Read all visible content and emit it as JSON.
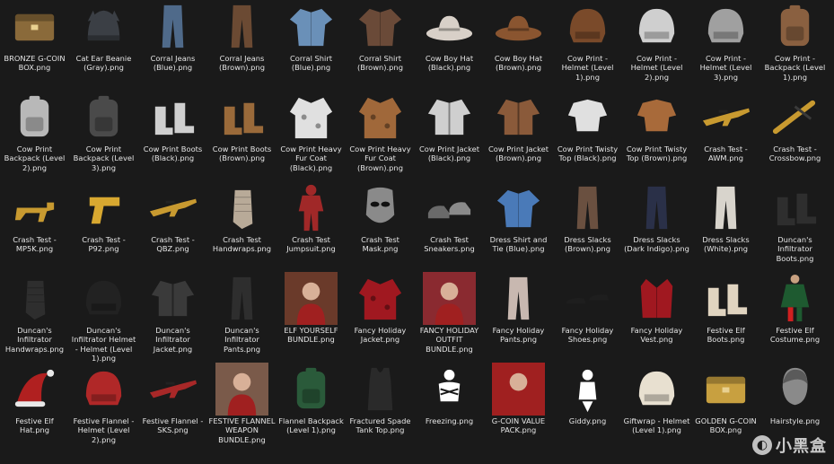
{
  "files": [
    {
      "name": "BRONZE G-COIN BOX.png",
      "icon": "crate-icon",
      "color": "#8a6a3a"
    },
    {
      "name": "Cat Ear Beanie (Gray).png",
      "icon": "beanie-icon",
      "color": "#3b3f45"
    },
    {
      "name": "Corral Jeans (Blue).png",
      "icon": "pants-icon",
      "color": "#4f6a8a"
    },
    {
      "name": "Corral Jeans (Brown).png",
      "icon": "pants-icon",
      "color": "#6b4a33"
    },
    {
      "name": "Corral Shirt (Blue).png",
      "icon": "shirt-icon",
      "color": "#6a90b8"
    },
    {
      "name": "Corral Shirt (Brown).png",
      "icon": "shirt-icon",
      "color": "#6a4a38"
    },
    {
      "name": "Cow Boy Hat (Black).png",
      "icon": "hat-icon",
      "color": "#d8d0c8"
    },
    {
      "name": "Cow Boy Hat (Brown).png",
      "icon": "hat-icon",
      "color": "#8a5530"
    },
    {
      "name": "Cow Print - Helmet (Level 1).png",
      "icon": "helmet-icon",
      "color": "#7a4a2a"
    },
    {
      "name": "Cow Print - Helmet (Level 2).png",
      "icon": "helmet-icon",
      "color": "#cfcfcf"
    },
    {
      "name": "Cow Print - Helmet (Level 3).png",
      "icon": "helmet-icon",
      "color": "#a0a0a0"
    },
    {
      "name": "Cow Print - Backpack (Level 1).png",
      "icon": "backpack-icon",
      "color": "#8a6040"
    },
    {
      "name": "Cow Print Backpack (Level 2).png",
      "icon": "backpack-icon",
      "color": "#b8b8b8"
    },
    {
      "name": "Cow Print Backpack (Level 3).png",
      "icon": "backpack-icon",
      "color": "#4a4a4a"
    },
    {
      "name": "Cow Print Boots (Black).png",
      "icon": "boots-icon",
      "color": "#cfcfcf"
    },
    {
      "name": "Cow Print Boots (Brown).png",
      "icon": "boots-icon",
      "color": "#9a6a3a"
    },
    {
      "name": "Cow Print Heavy Fur Coat (Black).png",
      "icon": "coat-icon",
      "color": "#e0e0e0"
    },
    {
      "name": "Cow Print Heavy Fur Coat (Brown).png",
      "icon": "coat-icon",
      "color": "#a0683a"
    },
    {
      "name": "Cow Print Jacket (Black).png",
      "icon": "jacket-icon",
      "color": "#cfcfcf"
    },
    {
      "name": "Cow Print Jacket (Brown).png",
      "icon": "jacket-icon",
      "color": "#8a5a3a"
    },
    {
      "name": "Cow Print Twisty Top (Black).png",
      "icon": "top-icon",
      "color": "#e0e0e0"
    },
    {
      "name": "Cow Print Twisty Top (Brown).png",
      "icon": "top-icon",
      "color": "#a86a3a"
    },
    {
      "name": "Crash Test - AWM.png",
      "icon": "rifle-icon",
      "color": "#c89a30"
    },
    {
      "name": "Crash Test - Crossbow.png",
      "icon": "crossbow-icon",
      "color": "#c89a30"
    },
    {
      "name": "Crash Test - MP5K.png",
      "icon": "smg-icon",
      "color": "#c89a30"
    },
    {
      "name": "Crash Test - P92.png",
      "icon": "pistol-icon",
      "color": "#d8a830"
    },
    {
      "name": "Crash Test - QBZ.png",
      "icon": "rifle-icon",
      "color": "#c89a30"
    },
    {
      "name": "Crash Test Handwraps.png",
      "icon": "handwraps-icon",
      "color": "#b8aa98"
    },
    {
      "name": "Crash Test Jumpsuit.png",
      "icon": "jumpsuit-icon",
      "color": "#a02828"
    },
    {
      "name": "Crash Test Mask.png",
      "icon": "mask-icon",
      "color": "#8a8a8a"
    },
    {
      "name": "Crash Test Sneakers.png",
      "icon": "sneakers-icon",
      "color": "#6a6a6a"
    },
    {
      "name": "Dress Shirt and Tie (Blue).png",
      "icon": "shirt-icon",
      "color": "#4a7ab8"
    },
    {
      "name": "Dress Slacks (Brown).png",
      "icon": "pants-icon",
      "color": "#6a5040"
    },
    {
      "name": "Dress Slacks (Dark Indigo).png",
      "icon": "pants-icon",
      "color": "#2a3048"
    },
    {
      "name": "Dress Slacks (White).png",
      "icon": "pants-icon",
      "color": "#d8d4cc"
    },
    {
      "name": "Duncan's Infiltrator Boots.png",
      "icon": "boots-icon",
      "color": "#2e2e2e"
    },
    {
      "name": "Duncan's Infiltrator Handwraps.png",
      "icon": "handwraps-icon",
      "color": "#2e2e2e"
    },
    {
      "name": "Duncan's Infiltrator Helmet - Helmet (Level 1).png",
      "icon": "helmet-icon",
      "color": "#222222"
    },
    {
      "name": "Duncan's Infiltrator Jacket.png",
      "icon": "jacket-icon",
      "color": "#3a3a3a"
    },
    {
      "name": "Duncan's Infiltrator Pants.png",
      "icon": "pants-icon",
      "color": "#2e2e2e"
    },
    {
      "name": "ELF YOURSELF BUNDLE.png",
      "icon": "bundle-photo-icon",
      "color": "#6a3a2a"
    },
    {
      "name": "Fancy Holiday Jacket.png",
      "icon": "coat-icon",
      "color": "#a01820"
    },
    {
      "name": "FANCY HOLIDAY OUTFIT BUNDLE.png",
      "icon": "bundle-photo-icon",
      "color": "#8a2a30"
    },
    {
      "name": "Fancy Holiday Pants.png",
      "icon": "pants-icon",
      "color": "#c8b8b0"
    },
    {
      "name": "Fancy Holiday Shoes.png",
      "icon": "shoes-icon",
      "color": "#1e1e1e"
    },
    {
      "name": "Fancy Holiday Vest.png",
      "icon": "vest-icon",
      "color": "#a01820"
    },
    {
      "name": "Festive Elf Boots.png",
      "icon": "boots-icon",
      "color": "#e0d4c0"
    },
    {
      "name": "Festive Elf Costume.png",
      "icon": "costume-icon",
      "color": "#1e5a30"
    },
    {
      "name": "Festive Elf Hat.png",
      "icon": "elf-hat-icon",
      "color": "#b02020"
    },
    {
      "name": "Festive Flannel - Helmet (Level 2).png",
      "icon": "helmet-icon",
      "color": "#b02828"
    },
    {
      "name": "Festive Flannel - SKS.png",
      "icon": "rifle-icon",
      "color": "#a82828"
    },
    {
      "name": "FESTIVE FLANNEL WEAPON BUNDLE.png",
      "icon": "bundle-photo-icon",
      "color": "#7a5a4a"
    },
    {
      "name": "Flannel Backpack (Level 1).png",
      "icon": "backpack-icon",
      "color": "#2a5a3a"
    },
    {
      "name": "Fractured Spade Tank Top.png",
      "icon": "tanktop-icon",
      "color": "#2a2a2a"
    },
    {
      "name": "Freezing.png",
      "icon": "emote-freezing-icon",
      "color": "#ffffff"
    },
    {
      "name": "G-COIN VALUE PACK.png",
      "icon": "bundle-photo-icon",
      "color": "#a02020"
    },
    {
      "name": "Giddy.png",
      "icon": "emote-giddy-icon",
      "color": "#ffffff"
    },
    {
      "name": "Giftwrap - Helmet (Level 1).png",
      "icon": "helmet-icon",
      "color": "#e8e0d0"
    },
    {
      "name": "GOLDEN G-COIN BOX.png",
      "icon": "crate-icon",
      "color": "#c8a040"
    },
    {
      "name": "Hairstyle.png",
      "icon": "head-icon",
      "color": "#8a8a8a"
    }
  ],
  "watermark": {
    "text": "小黑盒",
    "icon": "watermark-logo-icon"
  }
}
